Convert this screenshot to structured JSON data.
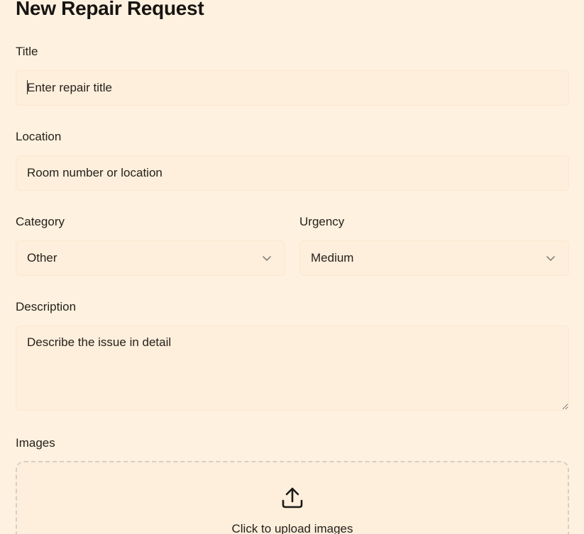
{
  "form": {
    "heading": "New Repair Request",
    "title": {
      "label": "Title",
      "placeholder": "Enter repair title"
    },
    "location": {
      "label": "Location",
      "placeholder": "Room number or location"
    },
    "category": {
      "label": "Category",
      "value": "Other"
    },
    "urgency": {
      "label": "Urgency",
      "value": "Medium"
    },
    "description": {
      "label": "Description",
      "placeholder": "Describe the issue in detail"
    },
    "images": {
      "label": "Images",
      "upload_text": "Click to upload images"
    }
  },
  "colors": {
    "background": "#fef1df",
    "field_background": "#fdefdc",
    "text": "#26211c",
    "dashed_border": "#d4cfc8"
  },
  "icons": {
    "select_chevron": "chevron-down-icon",
    "upload": "upload-icon"
  }
}
